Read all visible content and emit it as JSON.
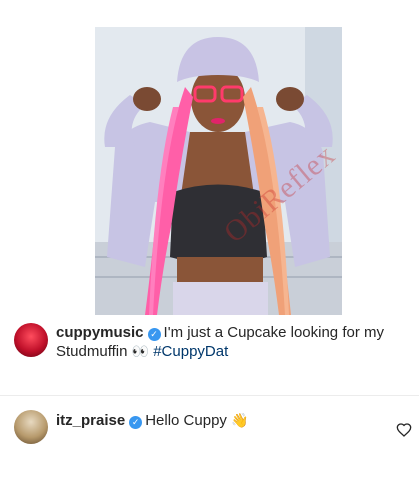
{
  "post": {
    "watermark": "ObiReflex"
  },
  "caption": {
    "username": "cuppymusic",
    "verified_icon": "verified-badge-icon",
    "text_1": "I'm just a Cupcake looking for my",
    "text_2": "Studmuffin",
    "emoji": "👀",
    "hashtag": "#CuppyDat"
  },
  "comment": {
    "username": "itz_praise",
    "verified_icon": "verified-badge-icon",
    "text": "Hello Cuppy",
    "emoji": "👋",
    "like_icon": "heart-outline-icon"
  },
  "colors": {
    "verified": "#3897f0",
    "hashtag": "#00376b",
    "text": "#262626"
  }
}
